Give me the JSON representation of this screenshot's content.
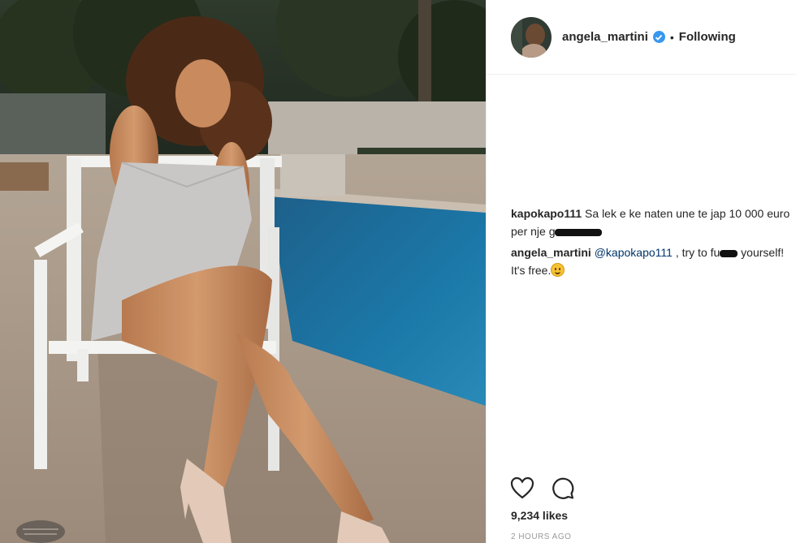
{
  "post": {
    "image_icon": "photo-woman-chair-pool",
    "header": {
      "avatar_icon": "avatar-icon",
      "username": "angela_martini",
      "verified_icon": "verified-badge-icon",
      "separator": "•",
      "follow_status": "Following"
    },
    "comments": [
      {
        "user": "kapokapo111",
        "text_before": " Sa lek e ke naten une te jap 10 000 euro per nje g",
        "redacted": true
      },
      {
        "user": "angela_martini",
        "mention": "@kapokapo111",
        "text_mid": " , try to fu",
        "redacted": true,
        "text_after": " yourself! It's free.",
        "emoji": "smiling-face-emoji"
      }
    ],
    "actions": {
      "like_icon": "heart-icon",
      "comment_icon": "comment-icon"
    },
    "likes": "9,234 likes",
    "timestamp": "2 HOURS AGO",
    "colors": {
      "verified": "#3897f0",
      "mention": "#003569",
      "text": "#262626",
      "muted": "#999999"
    }
  }
}
